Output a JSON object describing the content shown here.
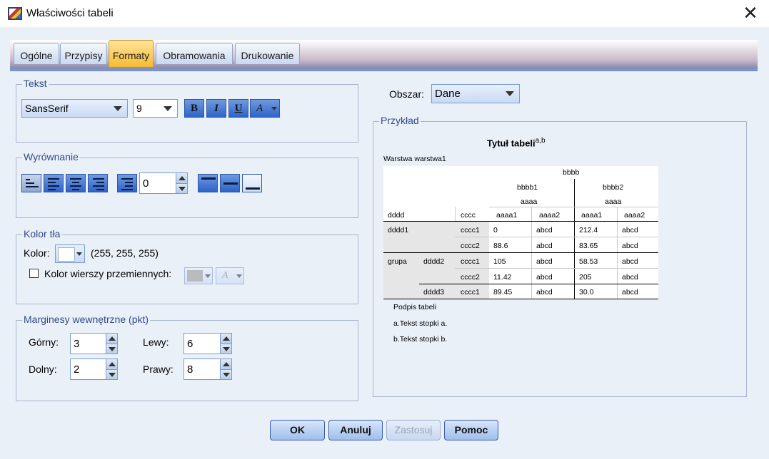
{
  "window": {
    "title": "Właściwości tabeli",
    "close_glyph": "✕"
  },
  "tabs": [
    {
      "label": "Ogólne",
      "active": false
    },
    {
      "label": "Przypisy",
      "active": false
    },
    {
      "label": "Formaty",
      "active": true
    },
    {
      "label": "Obramowania",
      "active": false
    },
    {
      "label": "Drukowanie",
      "active": false
    }
  ],
  "text_group": {
    "label": "Tekst",
    "font_family": "SansSerif",
    "font_size": "9",
    "bold": "B",
    "italic": "I",
    "underline": "U",
    "color_btn": "A"
  },
  "alignment_group": {
    "label": "Wyrównanie",
    "indent": "0"
  },
  "background_group": {
    "label": "Kolor tła",
    "color_label": "Kolor:",
    "color_value": "(255, 255, 255)",
    "swatch_color": "#ffffff",
    "alt_rows_label": "Kolor wierszy przemiennych:",
    "alt_rows_checked": false
  },
  "margins_group": {
    "label": "Marginesy wewnętrzne (pkt)",
    "top_label": "Górny:",
    "top": "3",
    "left_label": "Lewy:",
    "left": "6",
    "bottom_label": "Dolny:",
    "bottom": "2",
    "right_label": "Prawy:",
    "right": "8"
  },
  "area": {
    "label": "Obszar:",
    "value": "Dane"
  },
  "preview": {
    "label": "Przykład",
    "title": "Tytuł tabeli",
    "title_sup": "a,b",
    "layer": "Warstwa warstwa1",
    "header": {
      "bbbb": "bbbb",
      "bbbb1": "bbbb1",
      "bbbb2": "bbbb2",
      "aaaa_l": "aaaa",
      "aaaa_r": "aaaa",
      "dddd": "dddd",
      "cccc": "cccc",
      "c1": "aaaa1",
      "c2": "aaaa2",
      "c3": "aaaa1",
      "c4": "aaaa2"
    },
    "rows": [
      {
        "g": "dddd1",
        "d": "",
        "c": "cccc1",
        "v": [
          "0",
          "abcd",
          "212.4",
          "abcd"
        ]
      },
      {
        "g": "",
        "d": "",
        "c": "cccc2",
        "v": [
          "88.6",
          "abcd",
          "83.65",
          "abcd"
        ]
      },
      {
        "g": "grupa",
        "d": "dddd2",
        "c": "cccc1",
        "v": [
          "105",
          "abcd",
          "58.53",
          "abcd"
        ]
      },
      {
        "g": "",
        "d": "",
        "c": "cccc2",
        "v": [
          "11.42",
          "abcd",
          "205",
          "abcd"
        ]
      },
      {
        "g": "",
        "d": "dddd3",
        "c": "cccc1",
        "v": [
          "89.45",
          "abcd",
          "30.0",
          "abcd"
        ]
      }
    ],
    "caption": "Podpis tabeli",
    "footnote_a": "a.Tekst stopki a.",
    "footnote_b": "b.Tekst stopki b."
  },
  "buttons": {
    "ok": "OK",
    "cancel": "Anuluj",
    "apply": "Zastosuj",
    "help": "Pomoc"
  }
}
